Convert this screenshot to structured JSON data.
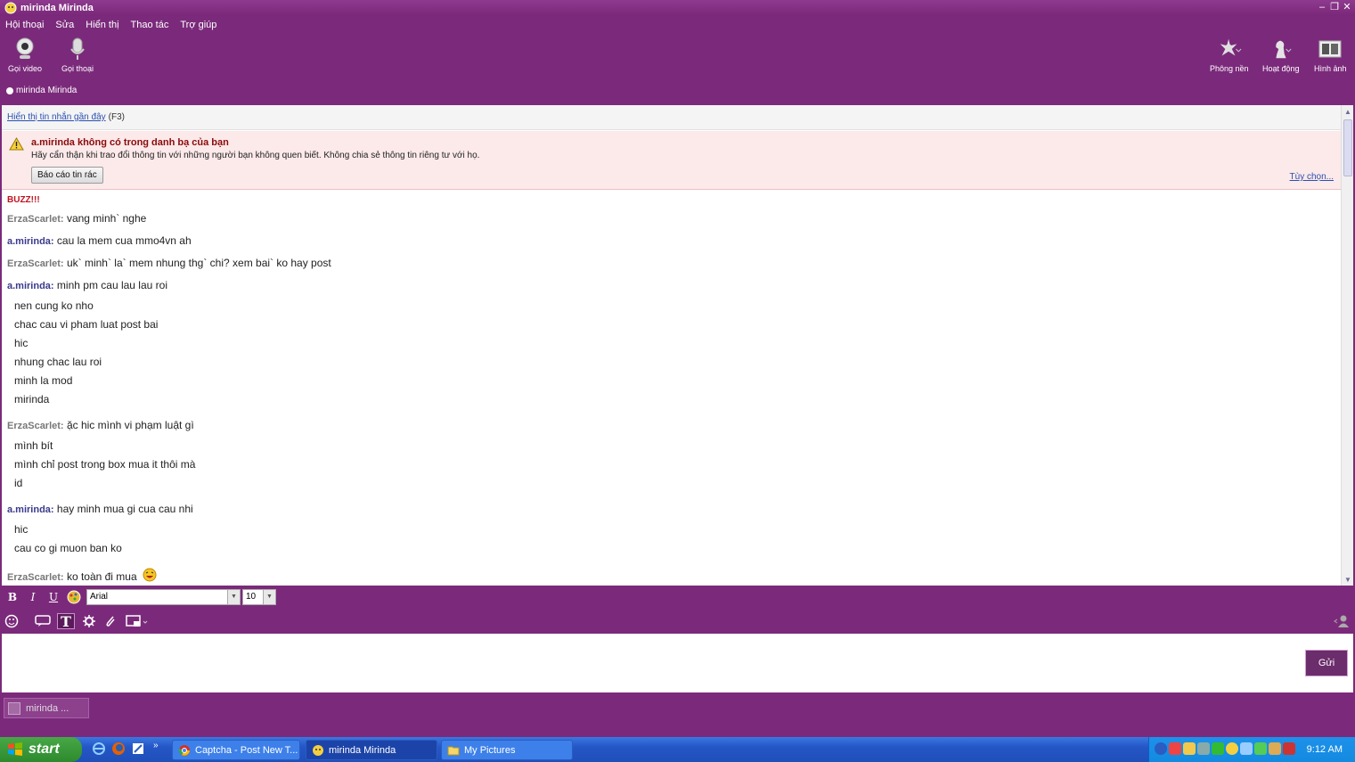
{
  "window": {
    "title": "mirinda Mirinda"
  },
  "menu": [
    "Hội thoại",
    "Sửa",
    "Hiển thị",
    "Thao tác",
    "Trợ giúp"
  ],
  "toolbar": {
    "video_call": "Gọi video",
    "voice_call": "Gọi thoại",
    "background": "Phông nền",
    "activity": "Hoạt động",
    "photos": "Hình ảnh"
  },
  "contact": {
    "name": "mirinda Mirinda"
  },
  "recent": {
    "link": "Hiển thị tin nhắn gần đây",
    "shortcut": "(F3)"
  },
  "warning": {
    "title": "a.mirinda không có trong danh bạ của bạn",
    "text": "Hãy cẩn thận khi trao đổi thông tin với những người bạn không quen biết. Không chia sẻ thông tin riêng tư với họ.",
    "spam_button": "Báo cáo tin rác",
    "options_link": "Tùy chọn..."
  },
  "chat": {
    "buzz": "BUZZ!!!",
    "messages": [
      {
        "sender": "ErzaScarlet:",
        "text": "vang minh` nghe",
        "cont": []
      },
      {
        "sender": "a.mirinda:",
        "text": "cau la mem cua mmo4vn ah",
        "cont": []
      },
      {
        "sender": "ErzaScarlet:",
        "text": "uk` minh` la` mem nhung thg` chi? xem bai` ko hay post",
        "cont": []
      },
      {
        "sender": "a.mirinda:",
        "text": "minh pm cau lau lau roi",
        "cont": [
          "nen cung ko nho",
          "chac cau vi pham luat post bai",
          "hic",
          "nhung chac lau roi",
          "minh la mod",
          "mirinda"
        ]
      },
      {
        "sender": "ErzaScarlet:",
        "text": "ặc hic mình vi phạm luật gì",
        "cont": [
          "mình bít",
          "mình chỉ post trong box mua it thôi  mà",
          "id"
        ]
      },
      {
        "sender": "a.mirinda:",
        "text": "hay minh mua gi cua cau nhi",
        "cont": [
          "hic",
          "cau co gi muon ban ko"
        ]
      },
      {
        "sender": "ErzaScarlet:",
        "text": "ko toàn đi mua",
        "cont": []
      }
    ]
  },
  "format": {
    "font": "Arial",
    "size": "10"
  },
  "input": {
    "send": "Gửi"
  },
  "conversation_tab": "mirinda ...",
  "taskbar": {
    "start": "start",
    "buttons": [
      "Captcha - Post New T...",
      "mirinda Mirinda",
      "My Pictures"
    ],
    "clock": "9:12 AM"
  }
}
